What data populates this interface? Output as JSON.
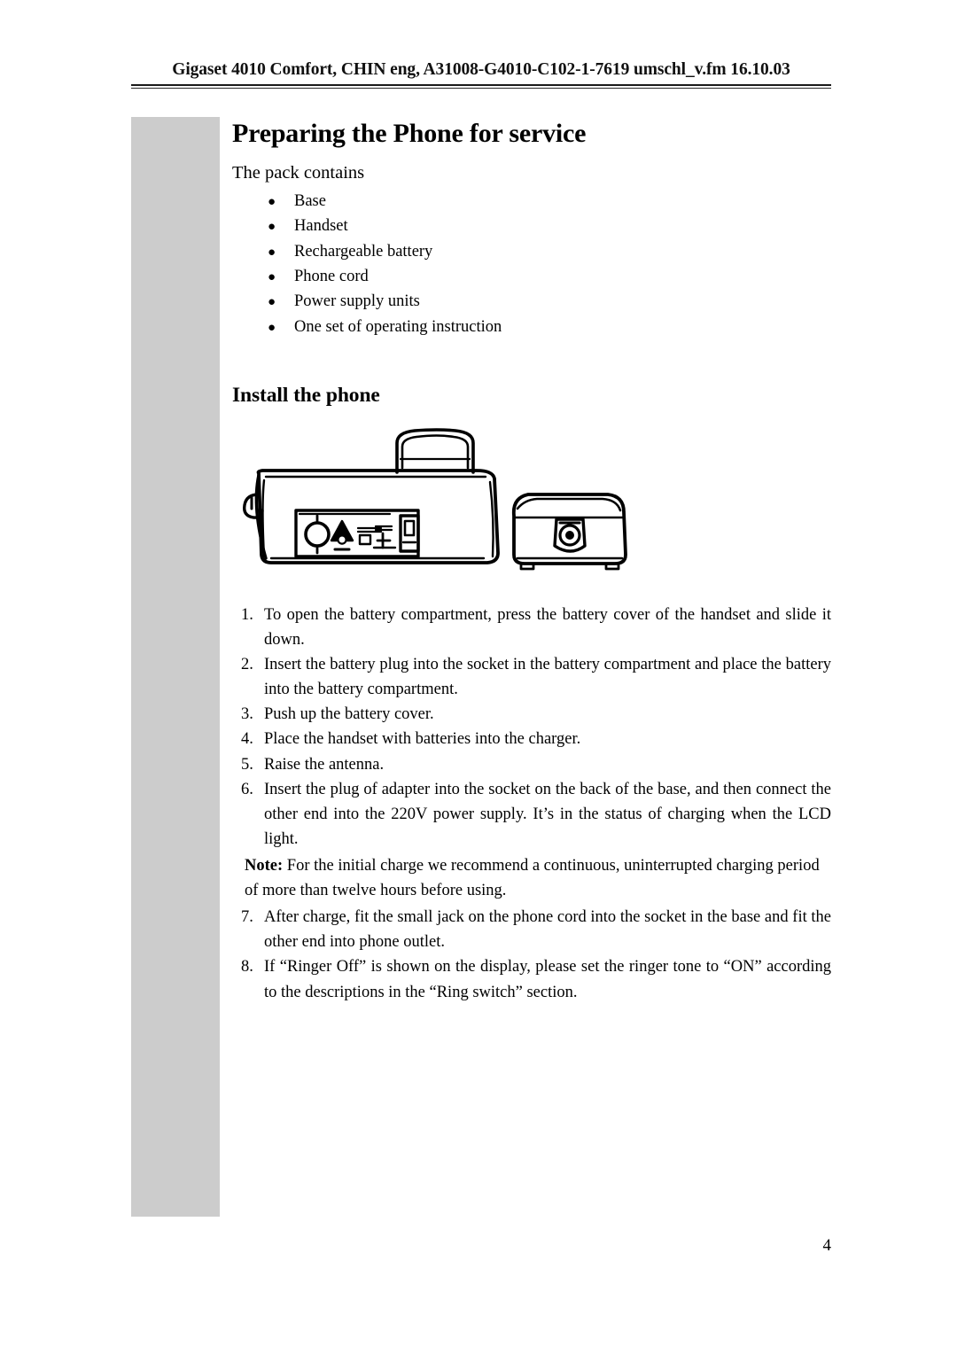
{
  "header": {
    "running_head": "Gigaset 4010 Comfort, CHIN eng, A31008-G4010-C102-1-7619 umschl_v.fm 16.10.03"
  },
  "page": {
    "title": "Preparing the Phone for service",
    "number": "4"
  },
  "pack": {
    "intro": "The pack contains",
    "bullet": "●",
    "items": [
      "Base",
      "Handset",
      "Rechargeable battery",
      "Phone cord",
      "Power supply units",
      "One set of operating instruction"
    ]
  },
  "install": {
    "heading": "Install the phone",
    "illustration_caption": "",
    "steps": [
      {
        "num": "1.",
        "text": "To open the battery compartment, press the battery cover of the handset and slide it down."
      },
      {
        "num": "2.",
        "text": "Insert the battery plug into the socket in the battery compartment and place the battery into the battery compartment."
      },
      {
        "num": "3.",
        "text": "Push up the battery cover."
      },
      {
        "num": "4.",
        "text": "Place the handset with batteries into the charger."
      },
      {
        "num": "5.",
        "text": "Raise the antenna."
      },
      {
        "num": "6.",
        "text": "Insert the plug of adapter into the socket on the back of the base, and then connect the other end into the 220V power supply. It’s in the status of charging when the LCD light."
      },
      {
        "num": "7.",
        "text": "After charge, fit the small jack on the phone cord into the socket in the base and fit the other end into phone outlet."
      },
      {
        "num": "8.",
        "text": "If “Ringer Off” is shown on the display, please set the ringer tone to “ON” according to the descriptions in the “Ring switch” section."
      }
    ],
    "note_label": "Note:",
    "note_text": " For the initial charge we recommend a continuous, uninterrupted charging period of more than twelve hours before using."
  },
  "colors": {
    "side_band": "#cccccc",
    "text": "#000000",
    "rule": "#1a1a1a"
  }
}
